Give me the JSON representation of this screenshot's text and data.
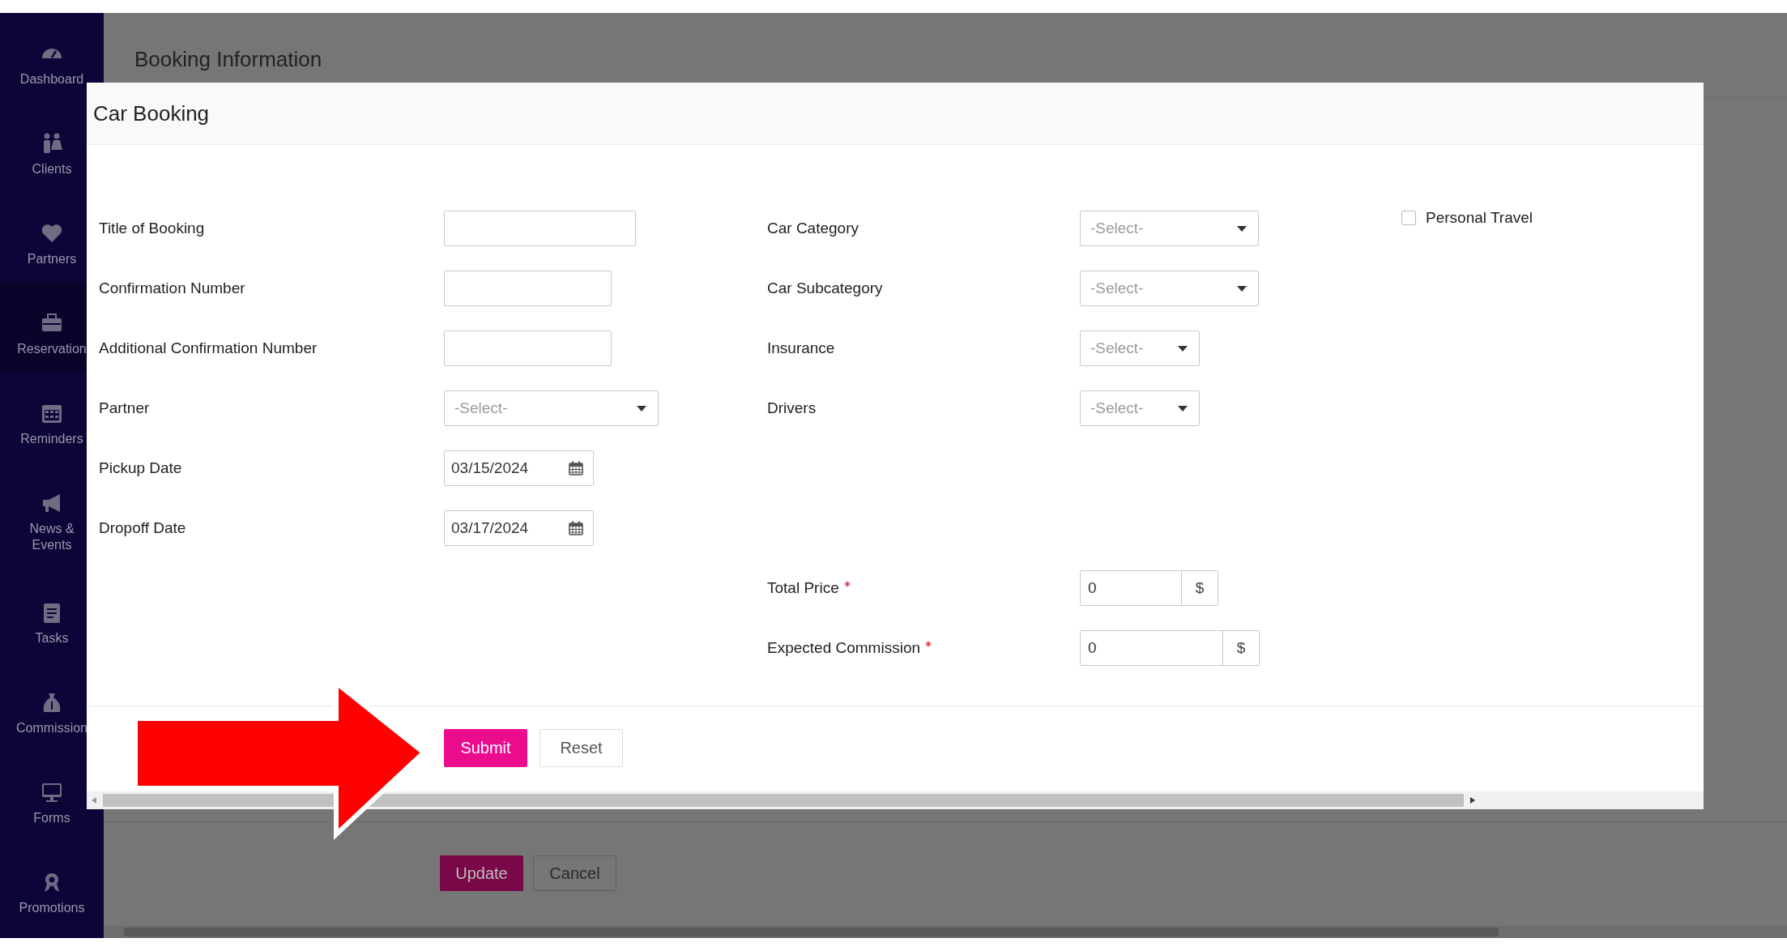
{
  "sidebar": {
    "items": [
      {
        "label": "Dashboard",
        "selected": false
      },
      {
        "label": "Clients",
        "selected": false
      },
      {
        "label": "Partners",
        "selected": false
      },
      {
        "label": "Reservation",
        "selected": true
      },
      {
        "label": "Reminders",
        "selected": false
      },
      {
        "label": "News & Events",
        "selected": false
      },
      {
        "label": "Tasks",
        "selected": false
      },
      {
        "label": "Commission",
        "selected": false
      },
      {
        "label": "Forms",
        "selected": false
      },
      {
        "label": "Promotions",
        "selected": false
      }
    ]
  },
  "page": {
    "title": "Booking Information",
    "buttons": [
      {
        "label": "Update",
        "kind": "primary"
      },
      {
        "label": "Cancel",
        "kind": "secondary"
      }
    ]
  },
  "modal": {
    "title": "Car Booking",
    "left_fields": [
      {
        "label": "Title of Booking",
        "kind": "text"
      },
      {
        "label": "Confirmation Number",
        "kind": "text"
      },
      {
        "label": "Additional Confirmation Number",
        "kind": "text"
      },
      {
        "label": "Partner",
        "kind": "select",
        "placeholder": "-Select-"
      },
      {
        "label": "Pickup Date",
        "kind": "date",
        "value": "03/15/2024"
      },
      {
        "label": "Dropoff Date",
        "kind": "date",
        "value": "03/17/2024"
      }
    ],
    "middle_fields": [
      {
        "label": "Car Category",
        "kind": "select",
        "placeholder": "-Select-"
      },
      {
        "label": "Car Subcategory",
        "kind": "select",
        "placeholder": "-Select-"
      },
      {
        "label": "Insurance",
        "kind": "select",
        "placeholder": "-Select-"
      },
      {
        "label": "Drivers",
        "kind": "select",
        "placeholder": "-Select-"
      }
    ],
    "price_fields": [
      {
        "label": "Total Price",
        "kind": "currency",
        "value": "0",
        "addon": "$",
        "required": true
      },
      {
        "label": "Expected Commission",
        "kind": "currency",
        "value": "0",
        "addon": "$",
        "required": true
      }
    ],
    "checkbox": {
      "label": "Personal Travel",
      "checked": false
    },
    "buttons": [
      {
        "label": "Submit",
        "kind": "primary"
      },
      {
        "label": "Reset",
        "kind": "secondary"
      }
    ]
  },
  "callout": {
    "kind": "arrow"
  }
}
